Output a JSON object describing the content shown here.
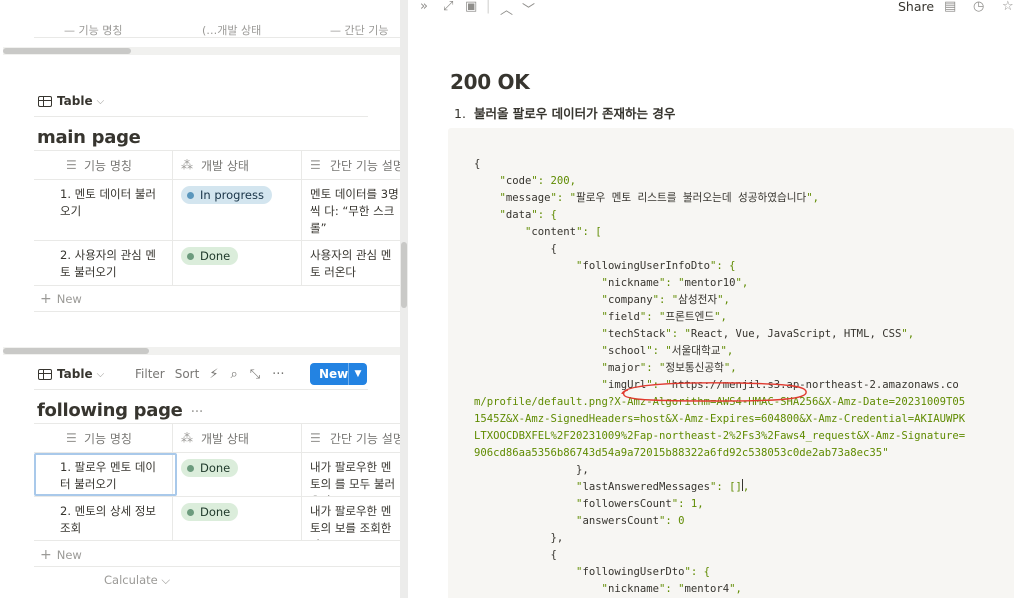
{
  "left": {
    "top_partial_texts": [
      "— 기능 명칭",
      "(…개발 상태",
      "— 간단 기능"
    ],
    "main": {
      "view_tab_label": "Table",
      "title": "main page",
      "columns": [
        "기능 명칭",
        "개발 상태",
        "간단 기능 설명"
      ],
      "rows": [
        {
          "name": "1. 멘토 데이터 불러오기",
          "status": "In progress",
          "status_color": "blue",
          "desc": "멘토 데이터를 3명씩 다: “무한 스크롤”"
        },
        {
          "name": "2. 사용자의 관심 멘토 불러오기",
          "status": "Done",
          "status_color": "green",
          "desc": "사용자의 관심 멘토 러온다"
        }
      ],
      "new_label": "New"
    },
    "following": {
      "view_tab_label": "Table",
      "toolbar": {
        "filter": "Filter",
        "sort": "Sort"
      },
      "new_button": "New",
      "title": "following page",
      "title_more": "···",
      "columns": [
        "기능 명칭",
        "개발 상태",
        "간단 기능 설명"
      ],
      "rows": [
        {
          "name": "1. 팔로우 멘토 데이터 불러오기",
          "status": "Done",
          "status_color": "green",
          "desc": "내가 팔로우한 멘토의 를 모두 불러온다"
        },
        {
          "name": "2. 멘토의 상세 정보 조회",
          "status": "Done",
          "status_color": "green",
          "desc": "내가 팔로우한 멘토의 보를 조회한다"
        }
      ],
      "new_label": "New",
      "calculate_label": "Calculate"
    }
  },
  "right": {
    "topbar": {
      "share": "Share"
    },
    "heading": "200 OK",
    "list_number": "1.",
    "list_text": "불러올 팔로우 데이터가 존재하는 경우",
    "code_lines": [
      "{",
      "    \"code\": 200,",
      "    \"message\": \"팔로우 멘토 리스트를 불러오는데 성공하였습니다\",",
      "    \"data\": {",
      "        \"content\": [",
      "            {",
      "                \"followingUserInfoDto\": {",
      "                    \"nickname\": \"mentor10\",",
      "                    \"company\": \"삼성전자\",",
      "                    \"field\": \"프론트엔드\",",
      "                    \"techStack\": \"React, Vue, JavaScript, HTML, CSS\",",
      "                    \"school\": \"서울대학교\",",
      "                    \"major\": \"정보통신공학\",",
      "                    \"imgUrl\": \"https://menjil.s3.ap-northeast-2.amazonaws.co",
      "m/profile/default.png?X-Amz-Algorithm=AWS4-HMAC-SHA256&X-Amz-Date=20231009T05",
      "1545Z&X-Amz-SignedHeaders=host&X-Amz-Expires=604800&X-Amz-Credential=AKIAUWPK",
      "LTXOOCDBXFEL%2F20231009%2Fap-northeast-2%2Fs3%2Faws4_request&X-Amz-Signature=",
      "906cd86aa5356b86743d54a9a72015b88322a6fd92c538053c0de2ab73a8ec35\"",
      "                },",
      "                \"lastAnsweredMessages\": [],",
      "                \"followersCount\": 1,",
      "                \"answersCount\": 0",
      "            },",
      "            {",
      "                \"followingUserDto\": {",
      "                    \"nickname\": \"mentor4\","
    ]
  },
  "colors": {
    "accent": "#2383e2",
    "code_string": "#5f8b00",
    "done_pill": "#dbeddb",
    "progress_pill": "#d3e5ef",
    "annotation": "#e03a2f"
  }
}
